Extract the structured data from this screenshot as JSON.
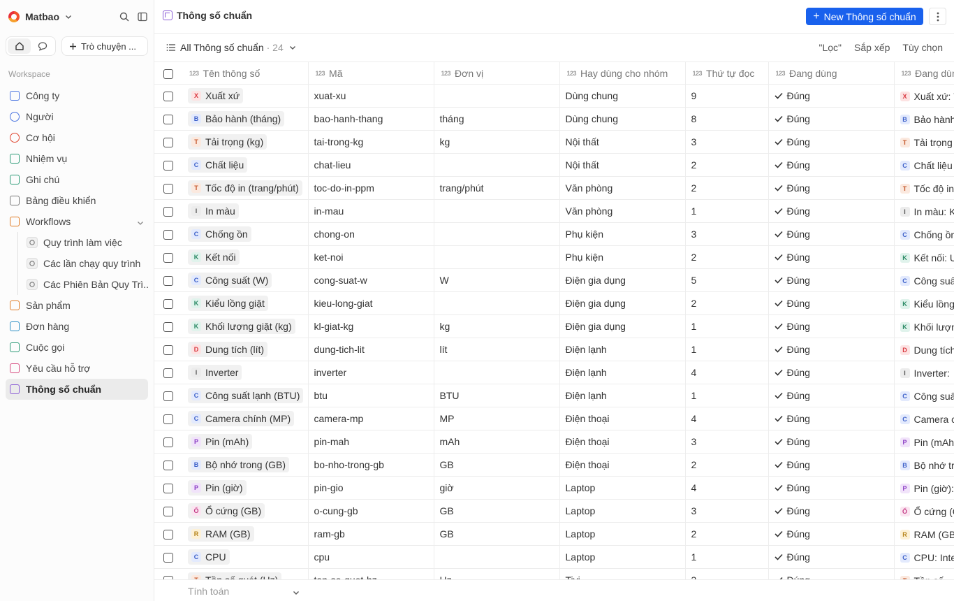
{
  "app": {
    "workspace_name": "Matbao",
    "chat_button_label": "Trò chuyện ..."
  },
  "sidebar": {
    "section_label": "Workspace",
    "items": [
      {
        "label": "Công ty",
        "icon": "building-icon",
        "color": "#4a74e0"
      },
      {
        "label": "Người",
        "icon": "user-icon",
        "color": "#4a74e0"
      },
      {
        "label": "Cơ hội",
        "icon": "target-icon",
        "color": "#e0452f"
      },
      {
        "label": "Nhiệm vụ",
        "icon": "checkbox-icon",
        "color": "#2b9a76"
      },
      {
        "label": "Ghi chú",
        "icon": "note-icon",
        "color": "#2b9a76"
      },
      {
        "label": "Bảng điều khiển",
        "icon": "dashboard-icon",
        "color": "#777777"
      },
      {
        "label": "Workflows",
        "icon": "workflow-icon",
        "color": "#e07b23"
      },
      {
        "label": "Quy trình làm việc",
        "icon": "settings-icon",
        "color": "#777777",
        "sub": true
      },
      {
        "label": "Các lần chạy quy trình",
        "icon": "history-icon",
        "color": "#777777",
        "sub": true
      },
      {
        "label": "Các Phiên Bản Quy Trì...",
        "icon": "versions-icon",
        "color": "#777777",
        "sub": true
      },
      {
        "label": "Sản phẩm",
        "icon": "box-icon",
        "color": "#e07b23"
      },
      {
        "label": "Đơn hàng",
        "icon": "cart-icon",
        "color": "#2b8fc4"
      },
      {
        "label": "Cuộc gọi",
        "icon": "phone-icon",
        "color": "#2b9a76"
      },
      {
        "label": "Yêu cầu hỗ trợ",
        "icon": "ticket-icon",
        "color": "#d6487e"
      },
      {
        "label": "Thông số chuẩn",
        "icon": "spec-icon",
        "color": "#8a5cd6",
        "active": true
      }
    ]
  },
  "header": {
    "title": "Thông số chuẩn",
    "new_button_label": "New Thông số chuẩn"
  },
  "viewbar": {
    "view_name": "All Thông số chuẩn",
    "count": "· 24",
    "filter_label": "\"Lọc\"",
    "sort_label": "Sắp xếp",
    "options_label": "Tùy chọn"
  },
  "table": {
    "columns": [
      "Tên thông số",
      "Mã",
      "Đơn vị",
      "Hay dùng cho nhóm",
      "Thứ tự đọc",
      "Đang dùng",
      "Đang dùng"
    ],
    "rows": [
      {
        "name": "Xuất xứ",
        "initial": "X",
        "code": "xuat-xu",
        "unit": "",
        "group": "Dùng chung",
        "order": "9",
        "active": "Đúng",
        "ref": "Xuất xứ: Việt Nam"
      },
      {
        "name": "Bảo hành (tháng)",
        "initial": "B",
        "code": "bao-hanh-thang",
        "unit": "tháng",
        "group": "Dùng chung",
        "order": "8",
        "active": "Đúng",
        "ref": "Bảo hành (tháng)"
      },
      {
        "name": "Tải trọng (kg)",
        "initial": "T",
        "code": "tai-trong-kg",
        "unit": "kg",
        "group": "Nội thất",
        "order": "3",
        "active": "Đúng",
        "ref": "Tải trọng (kg)"
      },
      {
        "name": "Chất liệu",
        "initial": "C",
        "code": "chat-lieu",
        "unit": "",
        "group": "Nội thất",
        "order": "2",
        "active": "Đúng",
        "ref": "Chất liệu"
      },
      {
        "name": "Tốc độ in (trang/phút)",
        "initial": "T",
        "code": "toc-do-in-ppm",
        "unit": "trang/phút",
        "group": "Văn phòng",
        "order": "2",
        "active": "Đúng",
        "ref": "Tốc độ in"
      },
      {
        "name": "In màu",
        "initial": "I",
        "code": "in-mau",
        "unit": "",
        "group": "Văn phòng",
        "order": "1",
        "active": "Đúng",
        "ref": "In màu: Không"
      },
      {
        "name": "Chống ồn",
        "initial": "C",
        "code": "chong-on",
        "unit": "",
        "group": "Phụ kiện",
        "order": "3",
        "active": "Đúng",
        "ref": "Chống ồn"
      },
      {
        "name": "Kết nối",
        "initial": "K",
        "code": "ket-noi",
        "unit": "",
        "group": "Phụ kiện",
        "order": "2",
        "active": "Đúng",
        "ref": "Kết nối: USB"
      },
      {
        "name": "Công suất (W)",
        "initial": "C",
        "code": "cong-suat-w",
        "unit": "W",
        "group": "Điện gia dụng",
        "order": "5",
        "active": "Đúng",
        "ref": "Công suất"
      },
      {
        "name": "Kiểu lồng giặt",
        "initial": "K",
        "code": "kieu-long-giat",
        "unit": "",
        "group": "Điện gia dụng",
        "order": "2",
        "active": "Đúng",
        "ref": "Kiểu lồng"
      },
      {
        "name": "Khối lượng giặt (kg)",
        "initial": "K",
        "code": "kl-giat-kg",
        "unit": "kg",
        "group": "Điện gia dụng",
        "order": "1",
        "active": "Đúng",
        "ref": "Khối lượng"
      },
      {
        "name": "Dung tích (lít)",
        "initial": "D",
        "code": "dung-tich-lit",
        "unit": "lít",
        "group": "Điện lạnh",
        "order": "1",
        "active": "Đúng",
        "ref": "Dung tích"
      },
      {
        "name": "Inverter",
        "initial": "I",
        "code": "inverter",
        "unit": "",
        "group": "Điện lạnh",
        "order": "4",
        "active": "Đúng",
        "ref": "Inverter:"
      },
      {
        "name": "Công suất lạnh (BTU)",
        "initial": "C",
        "code": "btu",
        "unit": "BTU",
        "group": "Điện lạnh",
        "order": "1",
        "active": "Đúng",
        "ref": "Công suất"
      },
      {
        "name": "Camera chính (MP)",
        "initial": "C",
        "code": "camera-mp",
        "unit": "MP",
        "group": "Điện thoại",
        "order": "4",
        "active": "Đúng",
        "ref": "Camera c"
      },
      {
        "name": "Pin (mAh)",
        "initial": "P",
        "code": "pin-mah",
        "unit": "mAh",
        "group": "Điện thoại",
        "order": "3",
        "active": "Đúng",
        "ref": "Pin (mAh"
      },
      {
        "name": "Bộ nhớ trong (GB)",
        "initial": "B",
        "code": "bo-nho-trong-gb",
        "unit": "GB",
        "group": "Điện thoại",
        "order": "2",
        "active": "Đúng",
        "ref": "Bộ nhớ tr"
      },
      {
        "name": "Pin (giờ)",
        "initial": "P",
        "code": "pin-gio",
        "unit": "giờ",
        "group": "Laptop",
        "order": "4",
        "active": "Đúng",
        "ref": "Pin (giờ):"
      },
      {
        "name": "Ổ cứng (GB)",
        "initial": "Ổ",
        "code": "o-cung-gb",
        "unit": "GB",
        "group": "Laptop",
        "order": "3",
        "active": "Đúng",
        "ref": "Ổ cứng (G"
      },
      {
        "name": "RAM (GB)",
        "initial": "R",
        "code": "ram-gb",
        "unit": "GB",
        "group": "Laptop",
        "order": "2",
        "active": "Đúng",
        "ref": "RAM (GB"
      },
      {
        "name": "CPU",
        "initial": "C",
        "code": "cpu",
        "unit": "",
        "group": "Laptop",
        "order": "1",
        "active": "Đúng",
        "ref": "CPU: Inte"
      },
      {
        "name": "Tần số quét (Hz)",
        "initial": "T",
        "code": "tan-so-quet-hz",
        "unit": "Hz",
        "group": "Tivi",
        "order": "3",
        "active": "Đúng",
        "ref": "Tần số"
      }
    ]
  },
  "footer": {
    "calc_label": "Tính toán"
  },
  "colors": {
    "accent": "#1961ed",
    "avatar_palette": {
      "X": [
        "#fde3e3",
        "#d9373f"
      ],
      "B": [
        "#e3eafd",
        "#3b5fc9"
      ],
      "T": [
        "#fbe9df",
        "#c4562a"
      ],
      "C": [
        "#e3eafd",
        "#3b5fc9"
      ],
      "I": [
        "#ececec",
        "#555555"
      ],
      "K": [
        "#e0f3ec",
        "#2b8a65"
      ],
      "D": [
        "#fde3e3",
        "#d9373f"
      ],
      "P": [
        "#f1e3fa",
        "#8a3cc4"
      ],
      "Ổ": [
        "#fbe5f1",
        "#c43c86"
      ],
      "R": [
        "#fdf1d6",
        "#b7851c"
      ]
    }
  }
}
